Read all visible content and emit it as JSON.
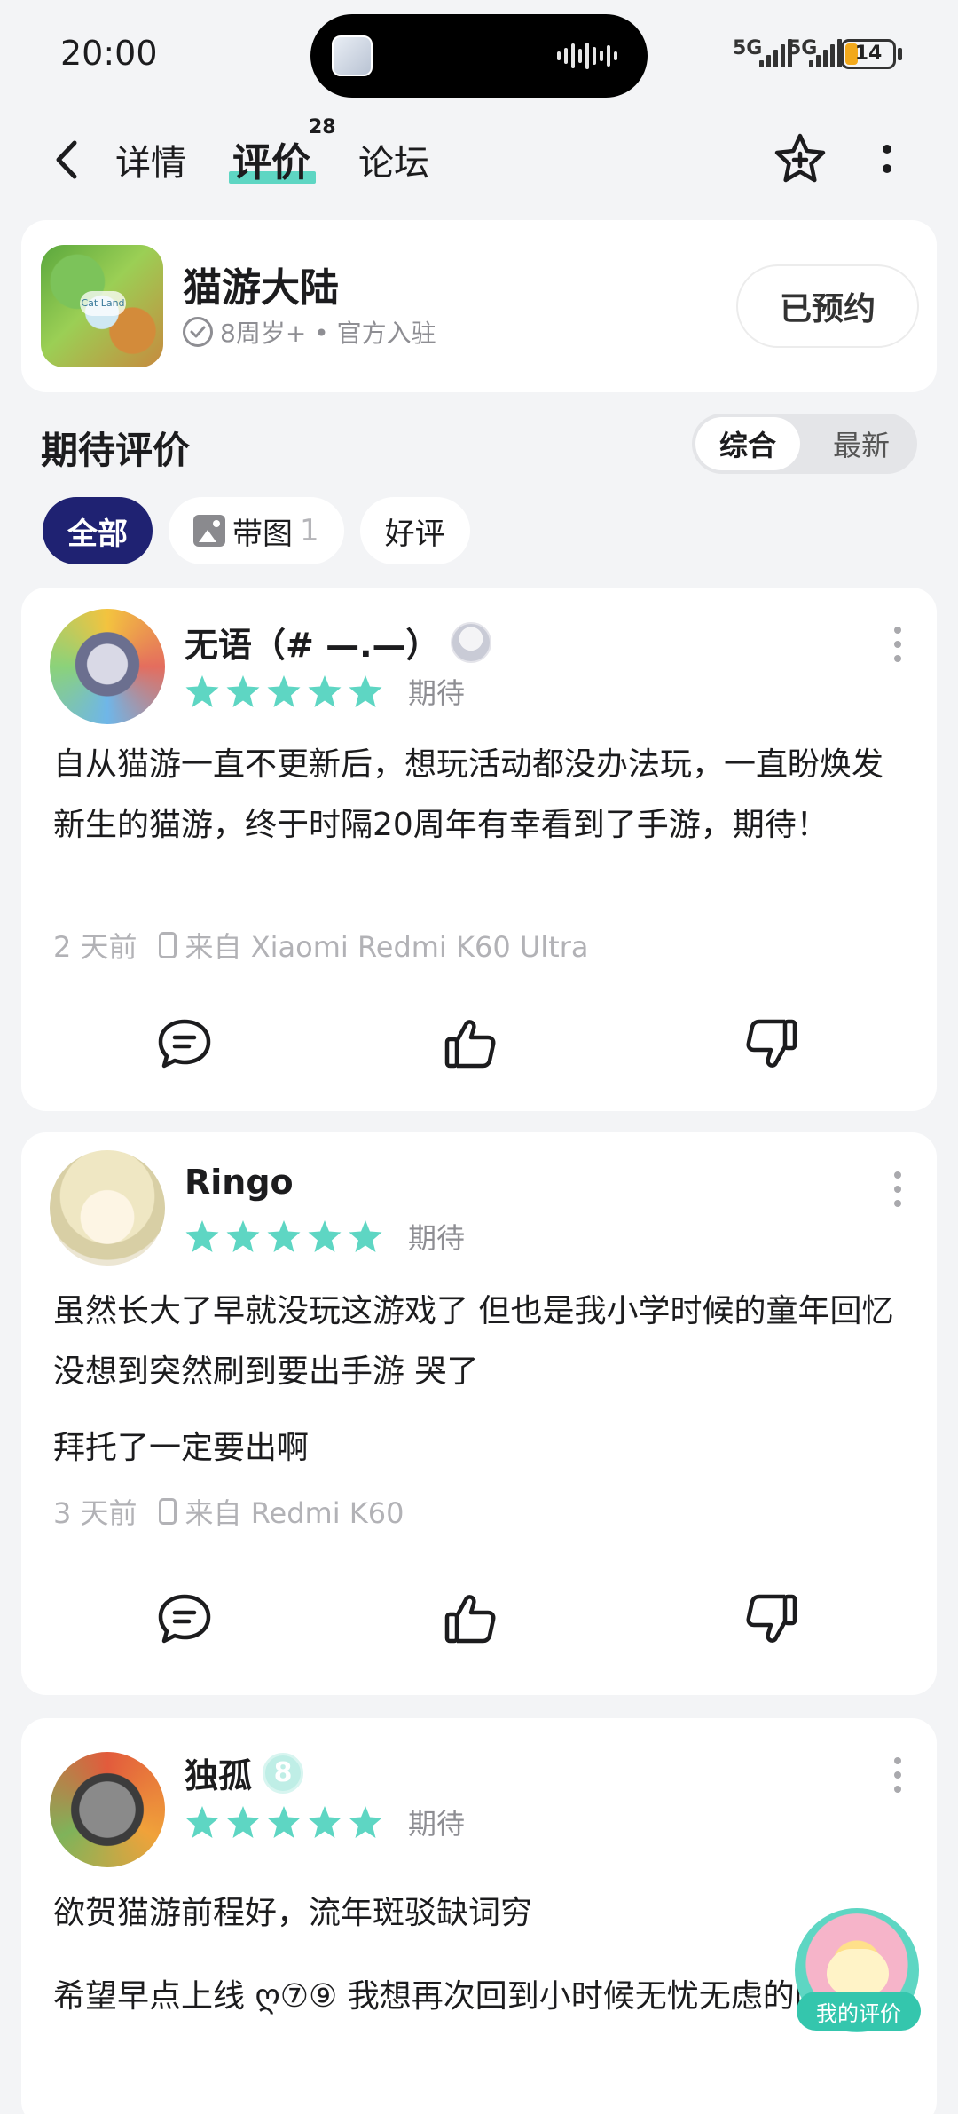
{
  "status": {
    "time": "20:00",
    "network1": "5G",
    "network2": "5G",
    "battery": "14"
  },
  "nav": {
    "tabs": [
      "详情",
      "评价",
      "论坛"
    ],
    "active_tab": "评价",
    "review_count": "28",
    "icons": [
      "back-icon",
      "star-plus-icon",
      "more-icon"
    ]
  },
  "game": {
    "title": "猫游大陆",
    "meta": "8周岁+ • 官方入驻",
    "icon_text": "Cat Land",
    "reserve_label": "已预约"
  },
  "section": {
    "title": "期待评价",
    "sort_options": [
      "综合",
      "最新"
    ],
    "active_sort": "综合"
  },
  "filters": [
    {
      "label": "全部",
      "count": ""
    },
    {
      "label": "带图",
      "count": "1"
    },
    {
      "label": "好评",
      "count": ""
    }
  ],
  "colors": {
    "accent": "#5ed6c3",
    "star": "#5ed6c3",
    "chip_active": "#1f2272"
  },
  "reviews": [
    {
      "user": "无语（# —.—）",
      "rating": 5,
      "tag": "期待",
      "paragraphs": [
        "自从猫游一直不更新后，想玩活动都没办法玩，一直盼焕发新生的猫游，终于时隔20周年有幸看到了手游，期待！"
      ],
      "time": "2 天前",
      "device": "来自 Xiaomi Redmi K60 Ultra"
    },
    {
      "user": "Ringo",
      "rating": 5,
      "tag": "期待",
      "paragraphs": [
        "虽然长大了早就没玩这游戏了 但也是我小学时候的童年回忆 没想到突然刷到要出手游 哭了",
        "拜托了一定要出啊"
      ],
      "time": "3 天前",
      "device": "来自 Redmi K60"
    },
    {
      "user": "独孤",
      "level": "8",
      "rating": 5,
      "tag": "期待",
      "paragraphs": [
        "欲贺猫游前程好，流年斑驳缺词穷",
        "希望早点上线 ღ⑦⑨ 我想再次回到小时候无忧无虑的时光！"
      ]
    }
  ],
  "fab": {
    "label": "我的评价"
  }
}
